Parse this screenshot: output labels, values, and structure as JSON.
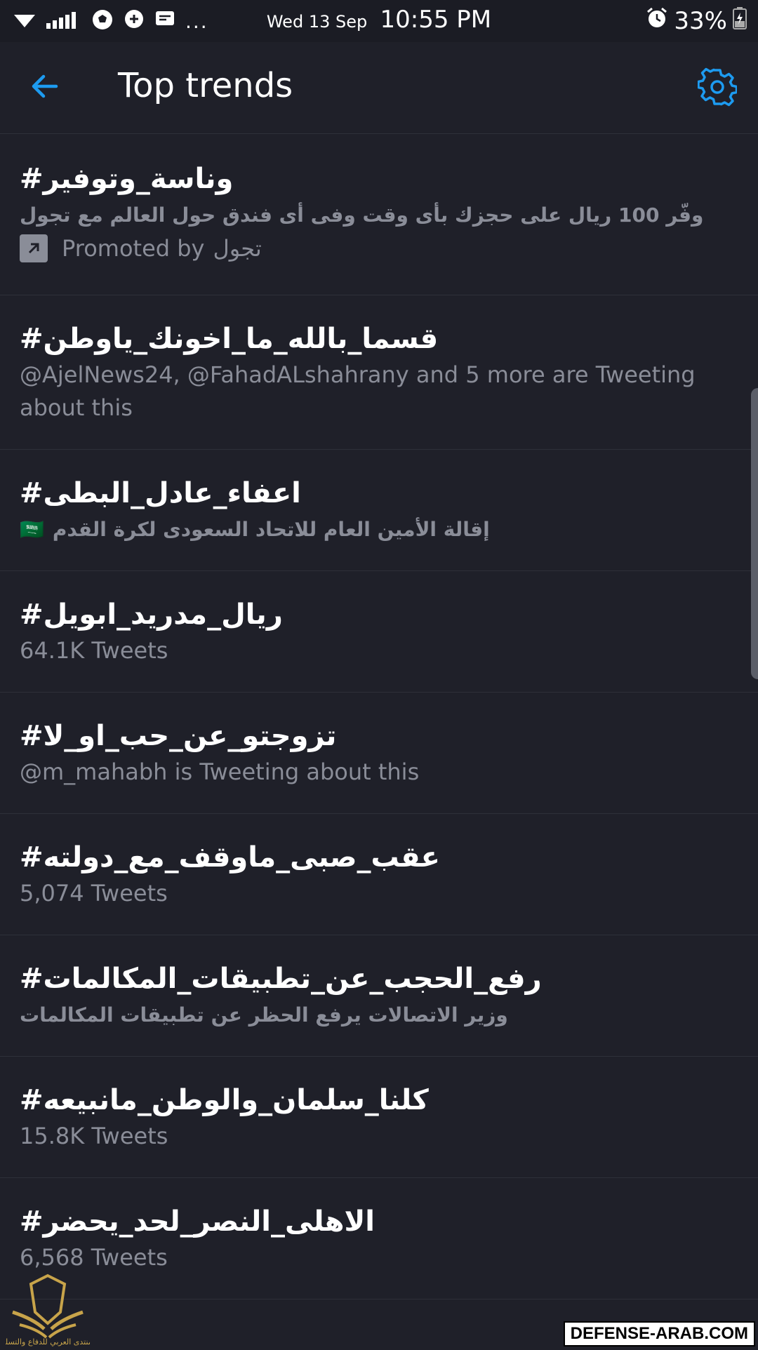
{
  "status_bar": {
    "date": "Wed 13 Sep",
    "time": "10:55 PM",
    "battery": "33%",
    "more": "...",
    "icons": [
      "wifi-icon",
      "signal-icon",
      "soccer-icon",
      "chat-plus-icon",
      "message-icon",
      "alarm-icon",
      "battery-icon"
    ]
  },
  "header": {
    "title": "Top trends",
    "back_icon": "arrow-left-icon",
    "settings_icon": "gear-icon"
  },
  "colors": {
    "background": "#1f2029",
    "accent": "#1d9bf0",
    "secondary_text": "#8a8d98",
    "divider": "#2e3039"
  },
  "trends": [
    {
      "name": "#وناسة_وتوفير",
      "meta": "وفّر 100 ريال على حجزك بأى وقت وفى أى فندق حول العالم مع تجول",
      "promoted_prefix": "Promoted by",
      "promoted_by": "تجول"
    },
    {
      "name": "#قسما_بالله_ما_اخونك_ياوطن",
      "meta": "@AjelNews24, @FahadALshahrany and 5 more are Tweeting about this"
    },
    {
      "name": "#اعفاء_عادل_البطى",
      "meta": "إقالة الأمين العام للاتحاد السعودى لكرة القدم",
      "flag": "🇸🇦"
    },
    {
      "name": "#ريال_مدريد_ابويل",
      "meta": "64.1K Tweets"
    },
    {
      "name": "#تزوجتو_عن_حب_او_لا",
      "meta": "@m_mahabh is Tweeting about this"
    },
    {
      "name": "#عقب_صبى_ماوقف_مع_دولته",
      "meta": "5,074 Tweets"
    },
    {
      "name": "#رفع_الحجب_عن_تطبيقات_المكالمات",
      "meta": "وزير الاتصالات يرفع الحظر عن تطبيقات المكالمات"
    },
    {
      "name": "#كلنا_سلمان_والوطن_مانبيعه",
      "meta": "15.8K Tweets"
    },
    {
      "name": "#الاهلى_النصر_لحد_يحضر",
      "meta": "6,568 Tweets"
    }
  ],
  "watermark": {
    "text": "DEFENSE-ARAB.COM",
    "logo_caption": "المنتدى العربي للدفاع والتسليح"
  }
}
